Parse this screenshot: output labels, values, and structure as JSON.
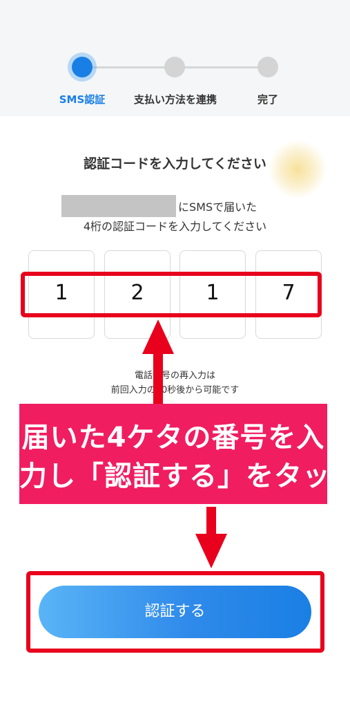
{
  "steps": [
    {
      "label": "SMS認証",
      "active": true
    },
    {
      "label": "支払い方法を連携",
      "active": false
    },
    {
      "label": "完了",
      "active": false
    }
  ],
  "title": "認証コードを入力してください",
  "instruction": {
    "line1": "にSMSで届いた",
    "line2": "4桁の認証コードを入力してください"
  },
  "code_digits": [
    "1",
    "2",
    "1",
    "7"
  ],
  "notice": {
    "line1": "電話番号の再入力は",
    "line2": "前回入力の30秒後から可能です"
  },
  "annotation": {
    "line1": "届いた4ケタの番号を入",
    "line2": "力し「認証する」をタップ"
  },
  "verify_button": {
    "label": "認証する"
  },
  "colors": {
    "primary": "#1a7fe4",
    "annotation_red": "#e8001c",
    "banner_pink": "#f01d61"
  }
}
